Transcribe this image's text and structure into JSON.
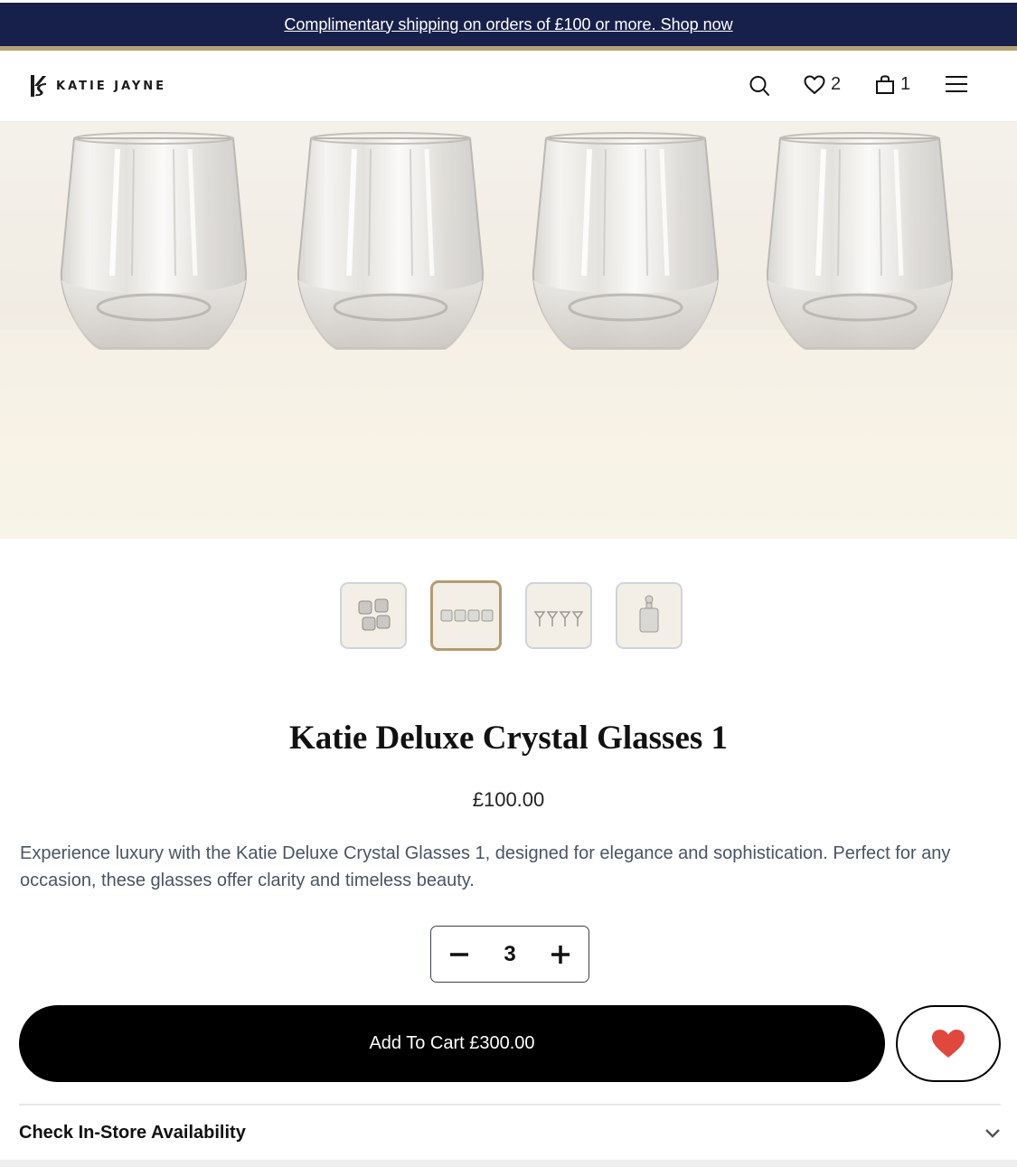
{
  "banner": {
    "text": "Complimentary shipping on orders of £100 or more. Shop now",
    "bg_color": "#16204a",
    "rule_color": "#b7a079"
  },
  "header": {
    "brand": "KATIE JAYNE",
    "search_icon": "search-icon",
    "wishlist_count": "2",
    "cart_count": "1",
    "menu_icon": "hamburger-menu-icon"
  },
  "gallery": {
    "thumbnails": [
      {
        "label": "tumblers-cluster",
        "active": false
      },
      {
        "label": "four-glasses-row",
        "active": true
      },
      {
        "label": "four-coupes-row",
        "active": false
      },
      {
        "label": "decanter",
        "active": false
      }
    ]
  },
  "product": {
    "title": "Katie Deluxe Crystal Glasses 1",
    "price": "£100.00",
    "description": "Experience luxury with the Katie Deluxe Crystal Glasses 1, designed for elegance and sophistication. Perfect for any occasion, these glasses offer clarity and timeless beauty.",
    "quantity": "3",
    "add_to_cart_label": "Add To Cart £300.00",
    "wishlist_heart_color": "#e0473d"
  },
  "accordion": {
    "store_availability_label": "Check In-Store Availability"
  }
}
